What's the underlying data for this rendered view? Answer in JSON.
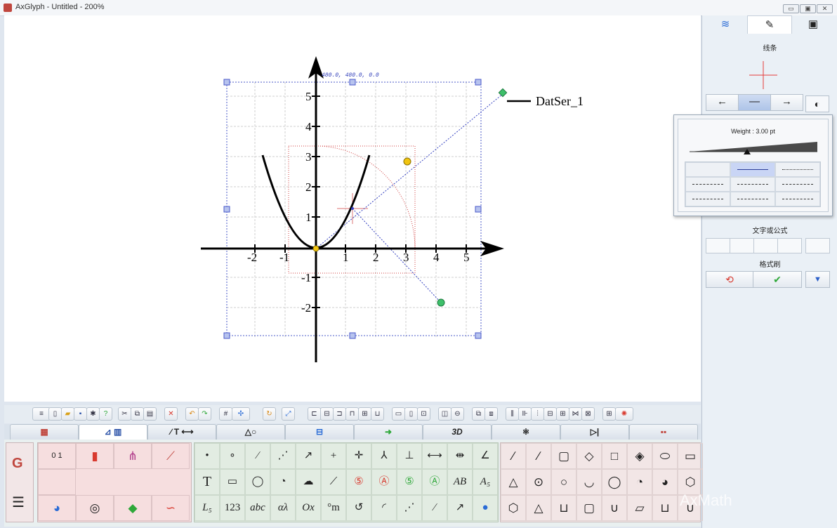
{
  "window": {
    "title": "AxGlyph - Untitled - 200%",
    "buttons": [
      "▭",
      "▣",
      "✕"
    ]
  },
  "canvas": {
    "coord_label": "480.0, 480.0, 0.0",
    "legend": "DatSer_1",
    "x_ticks": [
      "-2",
      "-1",
      "1",
      "2",
      "3",
      "4",
      "5"
    ],
    "y_ticks": [
      "5",
      "4",
      "3",
      "2",
      "1",
      "-1",
      "-2"
    ]
  },
  "right_panel": {
    "tabs": [
      "layers-icon",
      "palette-icon",
      "camera-icon"
    ],
    "section_line": "线条",
    "arrow_buttons": [
      "←",
      "—",
      "→"
    ],
    "section_text": "文字或公式",
    "section_brush": "格式刷"
  },
  "popup": {
    "weight_label": "Weight : 3.00 pt",
    "weight_value_pt": 3.0
  },
  "watermark": "AxMath"
}
